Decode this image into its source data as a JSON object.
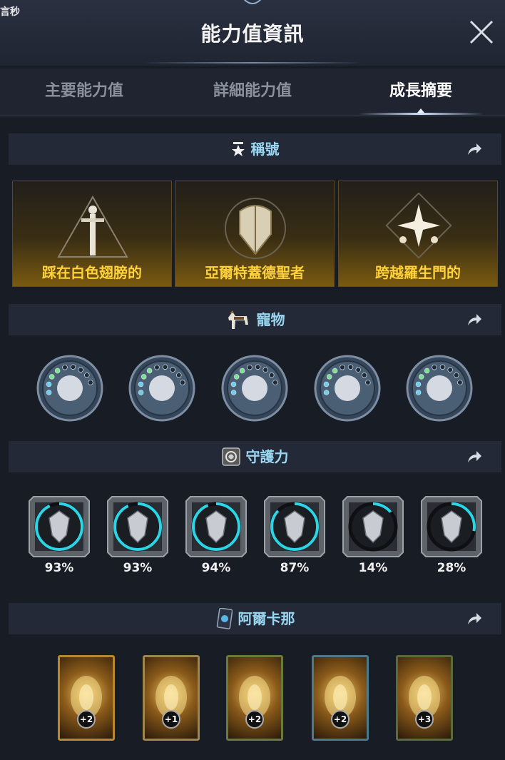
{
  "header": {
    "corner_text": "言秒",
    "title": "能力值資訊"
  },
  "tabs": [
    {
      "label": "主要能力值",
      "active": false
    },
    {
      "label": "詳細能力值",
      "active": false
    },
    {
      "label": "成長摘要",
      "active": true
    }
  ],
  "sections": {
    "titles": {
      "label": "稱號",
      "icon": "star-badge-icon"
    },
    "pets": {
      "label": "寵物",
      "icon": "horse-icon"
    },
    "guardian": {
      "label": "守護力",
      "icon": "guardian-emblem-icon"
    },
    "arcana": {
      "label": "阿爾卡那",
      "icon": "arcana-card-icon"
    }
  },
  "title_cards": [
    {
      "name": "踩在白色翅膀的",
      "emblem": "sword-triangle-icon"
    },
    {
      "name": "亞爾特蓋德聖者",
      "emblem": "shield-crest-icon"
    },
    {
      "name": "跨越羅生門的",
      "emblem": "four-star-icon"
    }
  ],
  "pets": [
    {
      "emblem": "mask-emblem-icon"
    },
    {
      "emblem": "wolf-emblem-icon"
    },
    {
      "emblem": "lotus-emblem-icon"
    },
    {
      "emblem": "spiral-emblem-icon"
    },
    {
      "emblem": "flower-emblem-icon"
    }
  ],
  "guardian": [
    {
      "percent": "93%",
      "progress": 0.93,
      "emblem": "crest-shield-icon"
    },
    {
      "percent": "93%",
      "progress": 0.93,
      "emblem": "winged-blade-icon"
    },
    {
      "percent": "94%",
      "progress": 0.94,
      "emblem": "hourglass-crest-icon"
    },
    {
      "percent": "87%",
      "progress": 0.87,
      "emblem": "butterfly-crest-icon"
    },
    {
      "percent": "14%",
      "progress": 0.14,
      "emblem": "star-crest-icon"
    },
    {
      "percent": "28%",
      "progress": 0.28,
      "emblem": "scales-crest-icon"
    }
  ],
  "arcana": [
    {
      "level": "+2",
      "art": "chalice-card-icon",
      "frame": "#b8892c"
    },
    {
      "level": "+1",
      "art": "scroll-card-icon",
      "frame": "#a0864c"
    },
    {
      "level": "+2",
      "art": "golden-tree-card-icon",
      "frame": "#6a7a3a"
    },
    {
      "level": "+2",
      "art": "bell-card-icon",
      "frame": "#4a7a8c"
    },
    {
      "level": "+3",
      "art": "ring-card-icon",
      "frame": "#5a6a3a"
    }
  ],
  "colors": {
    "accent_text": "#9ad7f2",
    "title_gold": "#ffd23a",
    "guardian_ring": "#2ad6e6",
    "background": "#181c25"
  }
}
